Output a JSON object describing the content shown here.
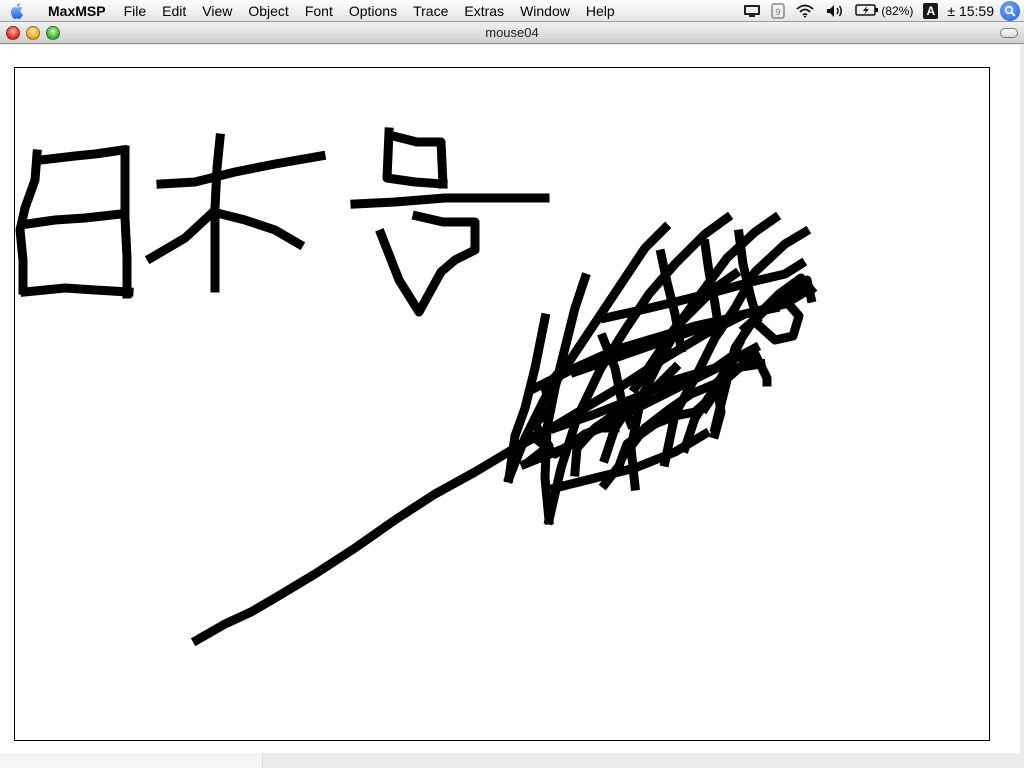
{
  "menubar": {
    "app_name": "MaxMSP",
    "items": [
      "File",
      "Edit",
      "View",
      "Object",
      "Font",
      "Options",
      "Trace",
      "Extras",
      "Window",
      "Help"
    ],
    "battery_text": "(82%)",
    "input_menu_label": "A",
    "clock": "± 15:59"
  },
  "window": {
    "title": "mouse04"
  }
}
